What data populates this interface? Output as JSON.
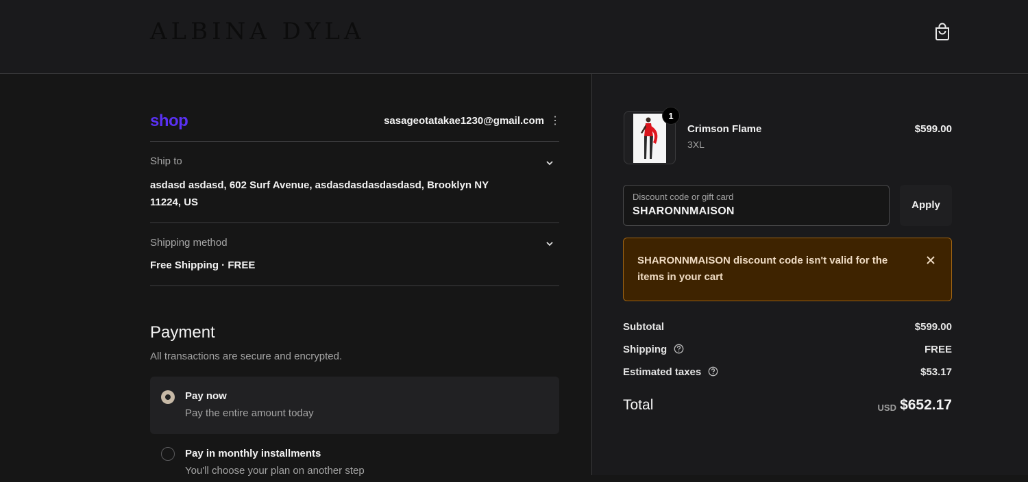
{
  "header": {
    "brand": "ALBINA DYLA",
    "cart_icon": "shopping-bag-icon"
  },
  "account": {
    "shop_logo": "shop",
    "email": "sasageotatakae1230@gmail.com",
    "menu_icon": "kebab-menu-icon"
  },
  "ship_to": {
    "label": "Ship to",
    "address_line1": "asdasd asdasd, 602 Surf Avenue, asdasdasdasdasdasd, Brooklyn NY",
    "address_line2": "11224, US"
  },
  "shipping_method": {
    "label": "Shipping method",
    "value": "Free Shipping · FREE"
  },
  "payment": {
    "title": "Payment",
    "subtitle": "All transactions are secure and encrypted.",
    "options": [
      {
        "title": "Pay now",
        "subtitle": "Pay the entire amount today",
        "selected": true
      },
      {
        "title": "Pay in monthly installments",
        "subtitle": "You'll choose your plan on another step",
        "selected": false
      }
    ]
  },
  "cart": {
    "items": [
      {
        "name": "Crimson Flame",
        "variant": "3XL",
        "price": "$599.00",
        "quantity": "1"
      }
    ]
  },
  "discount": {
    "placeholder": "Discount code or gift card",
    "value": "SHARONNMAISON",
    "apply_label": "Apply"
  },
  "alert": {
    "message": "SHARONNMAISON discount code isn't valid for the items in your cart",
    "color": "#3e2300"
  },
  "summary": {
    "subtotal_label": "Subtotal",
    "subtotal_value": "$599.00",
    "shipping_label": "Shipping",
    "shipping_value": "FREE",
    "taxes_label": "Estimated taxes",
    "taxes_value": "$53.17",
    "total_label": "Total",
    "total_currency": "USD",
    "total_value": "$652.17"
  },
  "colors": {
    "shop_purple": "#5a31f4",
    "radio_selected": "#c7b9a6",
    "alert_border": "#a06412"
  }
}
